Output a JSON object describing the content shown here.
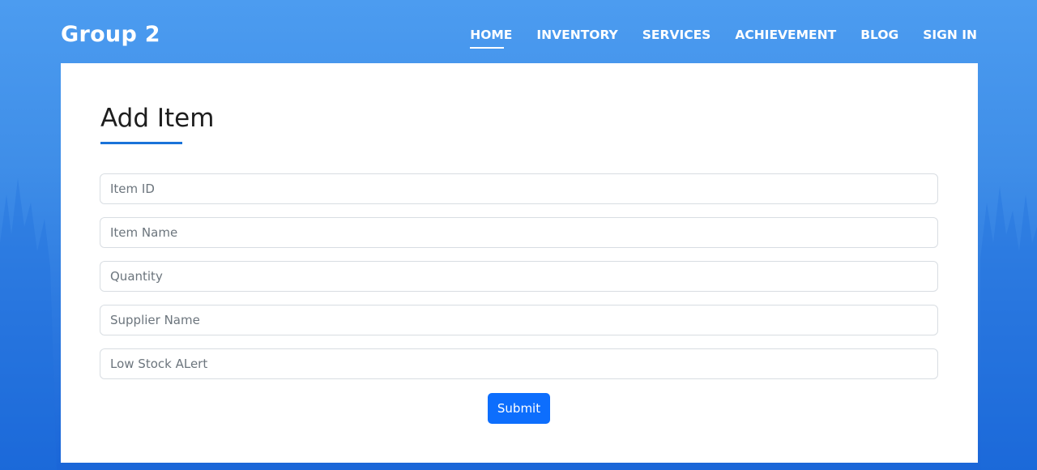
{
  "brand": "Group 2",
  "nav": {
    "items": [
      {
        "label": "HOME",
        "active": true
      },
      {
        "label": "INVENTORY",
        "active": false
      },
      {
        "label": "SERVICES",
        "active": false
      },
      {
        "label": "ACHIEVEMENT",
        "active": false
      },
      {
        "label": "BLOG",
        "active": false
      },
      {
        "label": "SIGN IN",
        "active": false
      }
    ]
  },
  "form": {
    "title": "Add Item",
    "fields": [
      {
        "placeholder": "Item ID",
        "value": ""
      },
      {
        "placeholder": "Item Name",
        "value": ""
      },
      {
        "placeholder": "Quantity",
        "value": ""
      },
      {
        "placeholder": "Supplier Name",
        "value": ""
      },
      {
        "placeholder": "Low Stock ALert",
        "value": ""
      }
    ],
    "submit_label": "Submit"
  },
  "colors": {
    "background_top": "#4c9cf0",
    "background_bottom": "#1a66d8",
    "accent": "#1a73d9",
    "button": "#0d6efd"
  }
}
